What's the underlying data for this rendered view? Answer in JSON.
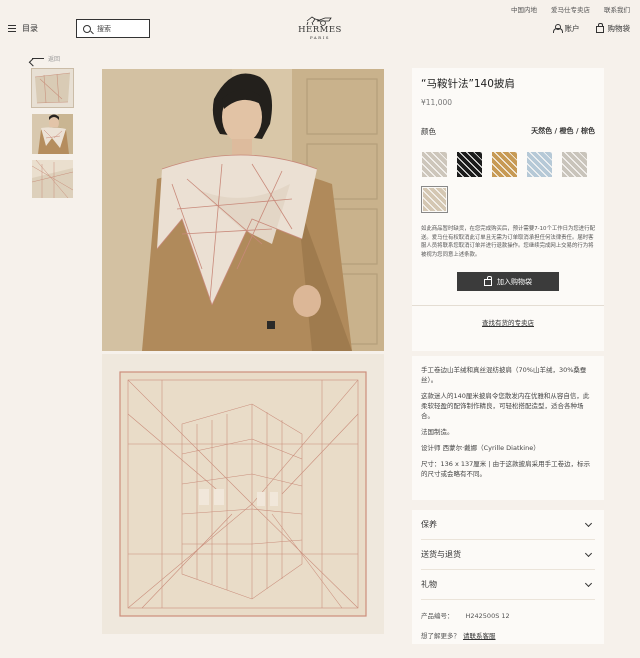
{
  "topbar": {
    "links": [
      "中国内地",
      "爱马仕专卖店",
      "联系我们"
    ]
  },
  "header": {
    "menu_label": "目录",
    "search_placeholder": "搜索",
    "logo_name": "HERMES",
    "logo_city": "PARIS",
    "account_label": "账户",
    "cart_label": "购物袋"
  },
  "nav": {
    "back_label": "返回"
  },
  "product": {
    "title": "“马鞍针法”140披肩",
    "price": "¥11,000",
    "color_label": "颜色",
    "color_value": "天然色 / 橙色 / 棕色",
    "swatches": [
      {
        "color": "#cdc6bb",
        "selected": false
      },
      {
        "color": "#1c1c1c",
        "selected": false
      },
      {
        "color": "#c79a55",
        "selected": false
      },
      {
        "color": "#b6c9d7",
        "selected": false
      },
      {
        "color": "#c9c4bb",
        "selected": false
      },
      {
        "color": "#d4c7b3",
        "selected": true
      }
    ],
    "notice": "如此商品暂时缺货，在您完成购买后，预计需要7-10个工作日为您进行配送。爱马仕有权取消此订单且无需为订单取消承担任何法律责任。届时客服人员将联系您取消订单并进行退款操作。您继续完成网上交易的行为将被视为您同意上述条款。",
    "add_to_cart_label": "加入购物袋",
    "find_store_label": "查找有货的专卖店"
  },
  "description": {
    "paragraphs": [
      "手工卷边山羊绒和真丝混纺披肩（70%山羊绒，30%桑蚕丝）。",
      "这款迷人的140厘米披肩令您散发内在优雅和从容自信，此柔软轻盈的配饰制作精良，可轻松搭配造型，适合各种场合。",
      "法国制造。",
      "设计师 西蒙尔·戴娜（Cyrille Diatkine）",
      "尺寸：136 x 137厘米 | 由于这款披肩采用手工卷边，标示的尺寸或会略有不同。"
    ]
  },
  "accordion": {
    "items": [
      "保养",
      "送货与退货",
      "礼物"
    ],
    "ref_label": "产品编号：",
    "ref_value": "H242500S 12",
    "contact_question": "想了解更多？",
    "contact_link": "请联系客服"
  }
}
